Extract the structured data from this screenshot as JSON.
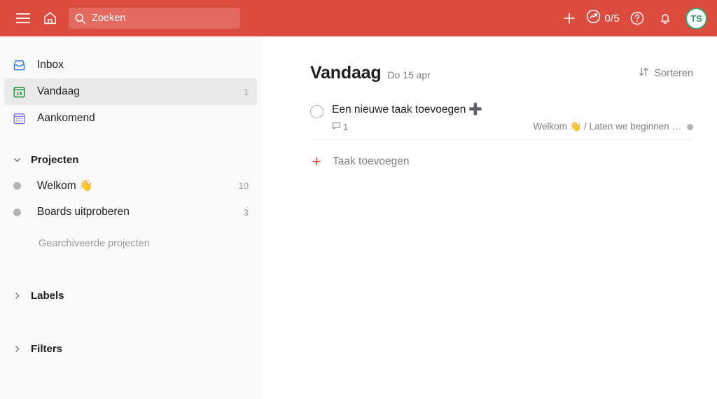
{
  "colors": {
    "header_red": "#db4c3f",
    "search_bg": "#e4695e",
    "sidebar_bg": "#fafafa",
    "selected_bg": "#eaeaea",
    "accent_red": "#dd4b39",
    "inbox_blue": "#246fe0",
    "today_green": "#058527",
    "upcoming_purple": "#7b68ee",
    "avatar_green": "#3ca36a",
    "muted_text": "#808080"
  },
  "header": {
    "menu_icon": "hamburger-menu-icon",
    "home_icon": "home-icon",
    "search": {
      "icon": "search-icon",
      "placeholder": "Zoeken",
      "value": ""
    },
    "add_icon": "plus-icon",
    "productivity": {
      "icon": "productivity-trend-icon",
      "count": "0/5"
    },
    "help_icon": "question-mark-icon",
    "notifications_icon": "bell-icon",
    "avatar_initials": "TS"
  },
  "sidebar": {
    "nav": [
      {
        "label": "Inbox",
        "icon": "inbox-icon",
        "count": "",
        "selected": false
      },
      {
        "label": "Vandaag",
        "icon": "today-calendar-icon",
        "count": "1",
        "selected": true
      },
      {
        "label": "Aankomend",
        "icon": "upcoming-calendar-icon",
        "count": "",
        "selected": false
      }
    ],
    "projects_section": {
      "title": "Projecten",
      "chevron": "chevron-down-icon",
      "items": [
        {
          "label": "Welkom 👋",
          "count": "10",
          "dot_color": "#b3b3b3"
        },
        {
          "label": "Boards uitproberen",
          "count": "3",
          "dot_color": "#b3b3b3"
        }
      ],
      "archived_label": "Gearchiveerde projecten"
    },
    "labels_section": {
      "title": "Labels",
      "chevron": "chevron-right-icon"
    },
    "filters_section": {
      "title": "Filters",
      "chevron": "chevron-right-icon"
    }
  },
  "main": {
    "title": "Vandaag",
    "subtitle": "Do 15 apr",
    "sort": {
      "label": "Sorteren",
      "icon": "sort-arrows-icon"
    },
    "tasks": [
      {
        "title": "Een nieuwe taak toevoegen",
        "title_emoji": "➕",
        "comment_icon": "comment-bubble-icon",
        "comment_count": "1",
        "project": "Welkom 👋 / Laten we beginnen …",
        "project_dot": "#b3b3b3"
      }
    ],
    "add_task": {
      "icon": "plus-icon",
      "label": "Taak toevoegen"
    }
  }
}
